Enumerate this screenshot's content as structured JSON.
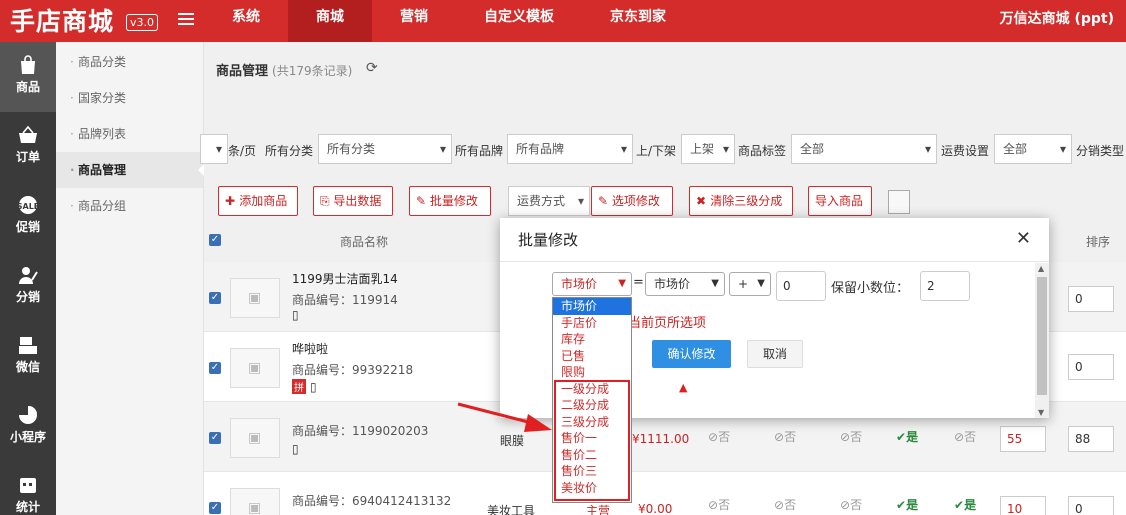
{
  "header": {
    "logo": "手店商城",
    "version": "v3.0",
    "nav": [
      "系统",
      "商城",
      "营销",
      "自定义模板",
      "京东到家"
    ],
    "active_nav": 1,
    "account": "万信达商城 (ppt)"
  },
  "sidebar": {
    "items": [
      {
        "label": "商品",
        "icon": "shopping-bag-icon"
      },
      {
        "label": "订单",
        "icon": "basket-icon"
      },
      {
        "label": "促销",
        "icon": "promo-badge-icon"
      },
      {
        "label": "分销",
        "icon": "distribution-icon"
      },
      {
        "label": "微信",
        "icon": "wechat-register-icon"
      },
      {
        "label": "小程序",
        "icon": "pie-chart-icon"
      },
      {
        "label": "统计",
        "icon": "calendar-icon"
      }
    ]
  },
  "subsidebar": {
    "items": [
      "商品分类",
      "国家分类",
      "品牌列表",
      "商品管理",
      "商品分组"
    ],
    "active": 3
  },
  "page": {
    "title": "商品管理",
    "count": "(共179条记录)"
  },
  "filters": {
    "per_page_label": "条/页",
    "category_label": "所有分类",
    "category_value": "所有分类",
    "brand_label": "所有品牌",
    "brand_value": "所有品牌",
    "shelf_label": "上/下架",
    "shelf_value": "上架",
    "tag_label": "商品标签",
    "tag_value": "全部",
    "freight_label": "运费设置",
    "freight_value": "全部",
    "dist_label": "分销类型"
  },
  "toolbar": {
    "add": "添加商品",
    "export": "导出数据",
    "batch": "批量修改",
    "freight": "运费方式",
    "option_edit": "选项修改",
    "clear_dist": "清除三级分成",
    "import": "导入商品"
  },
  "table": {
    "col_name": "商品名称",
    "col_sort": "排序",
    "rows": [
      {
        "name": "1199男士洁面乳14",
        "code": "商品编号：119914",
        "sort": "0",
        "stock": "0"
      },
      {
        "name": "哗啦啦",
        "code": "商品编号：99392218",
        "pin": "拼",
        "sort": "0",
        "stock": "0"
      },
      {
        "name": "",
        "code": "商品编号：1199020203",
        "category": "眼膜",
        "price": "¥1111.00",
        "flags": [
          "否",
          "否",
          "否",
          "是",
          "否"
        ],
        "stock": "55",
        "sort": "88"
      },
      {
        "name": "",
        "code": "商品编号：6940412413132",
        "category": "美妆工具",
        "price": "¥0.00",
        "status": "主营",
        "flags": [
          "否",
          "否",
          "否",
          "是",
          "是"
        ],
        "stock": "10",
        "sort": "0"
      }
    ]
  },
  "modal": {
    "title": "批量修改",
    "field_value": "市场价",
    "equals": "=",
    "source_value": "市场价",
    "operator": "+",
    "amount": "0",
    "decimal_label": "保留小数位：",
    "decimal_value": "2",
    "hint": "当前页所选项",
    "confirm": "确认修改",
    "cancel": "取消"
  },
  "dropdown": {
    "options": [
      "市场价",
      "手店价",
      "库存",
      "已售",
      "限购",
      "一级分成",
      "二级分成",
      "三级分成",
      "售价一",
      "售价二",
      "售价三",
      "美妆价"
    ],
    "selected": 0
  }
}
